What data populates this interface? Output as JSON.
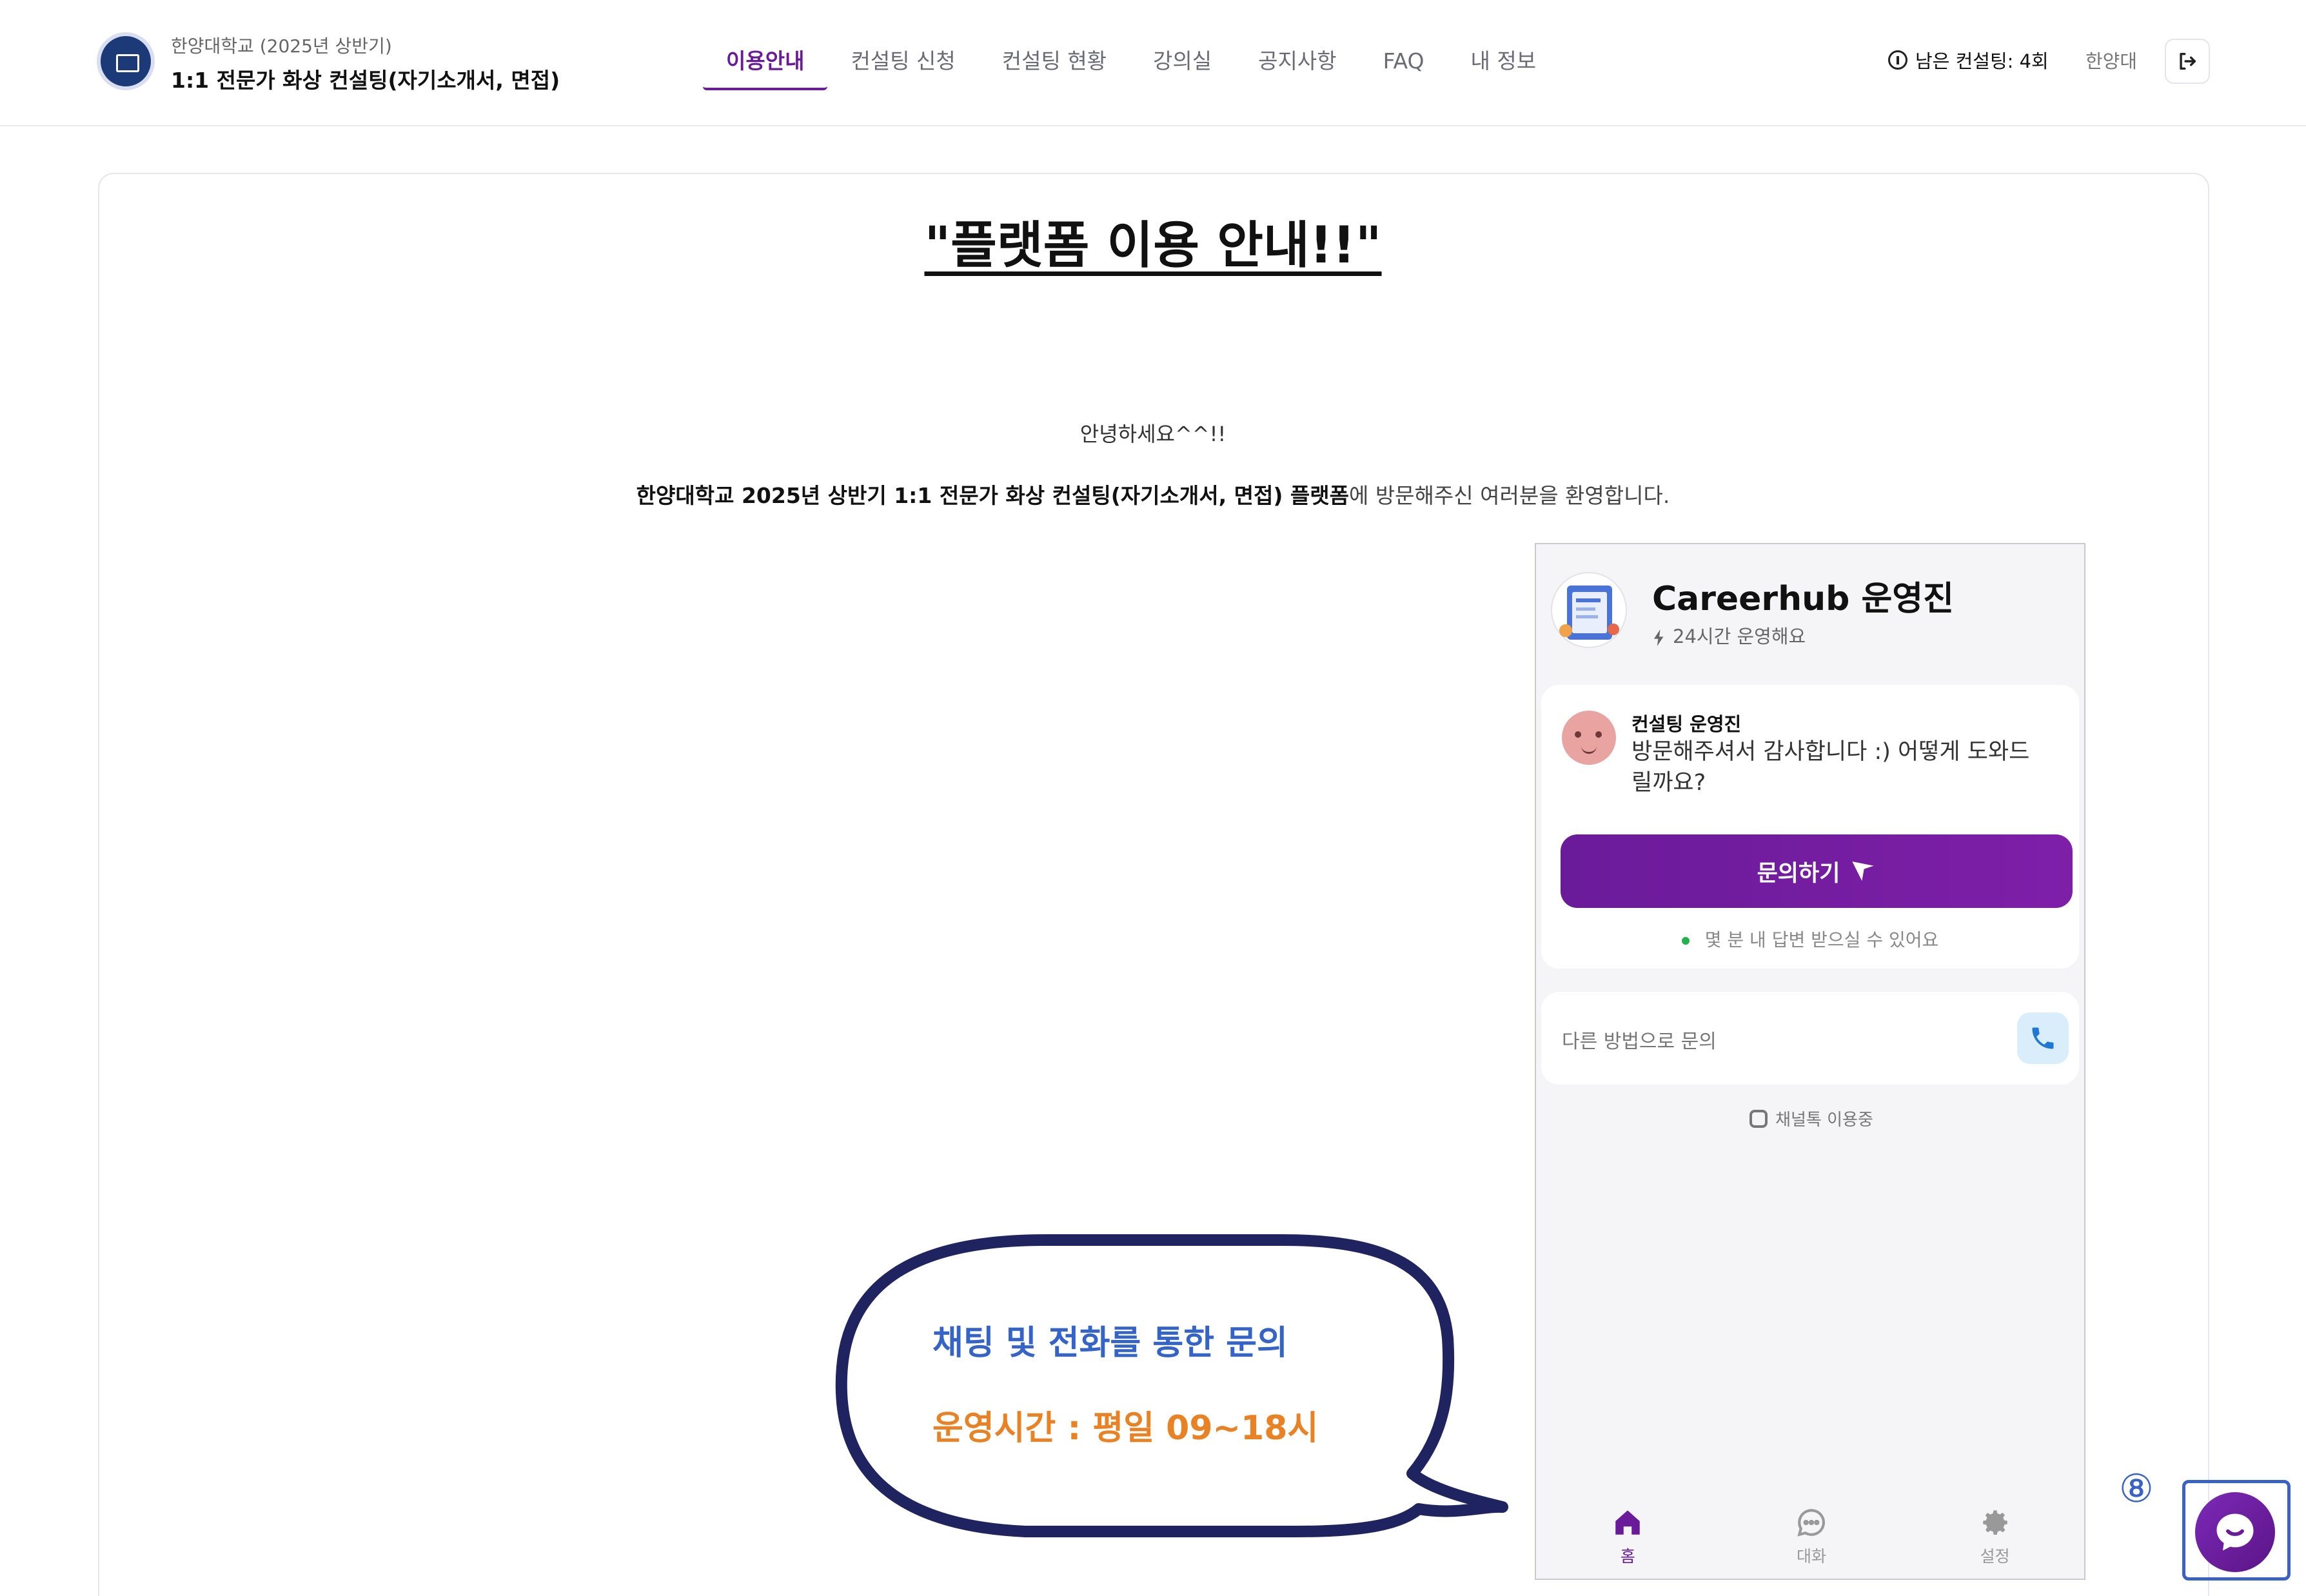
{
  "header": {
    "org": "한양대학교 (2025년 상반기)",
    "program": "1:1 전문가 화상 컨설팅(자기소개서, 면접)",
    "nav": [
      {
        "label": "이용안내",
        "active": true
      },
      {
        "label": "컨설팅 신청",
        "active": false
      },
      {
        "label": "컨설팅 현황",
        "active": false
      },
      {
        "label": "강의실",
        "active": false
      },
      {
        "label": "공지사항",
        "active": false
      },
      {
        "label": "FAQ",
        "active": false
      },
      {
        "label": "내 정보",
        "active": false
      }
    ],
    "remaining_label": "남은 컨설팅: 4회",
    "user": "한양대",
    "icons": {
      "info": "info-icon",
      "logout": "logout-icon"
    }
  },
  "notice": {
    "title": "\"플랫폼 이용 안내!!\"",
    "greeting": "안녕하세요^^!!",
    "welcome_bold": "한양대학교 2025년 상반기 1:1 전문가 화상 컨설팅(자기소개서, 면접) 플랫폼",
    "welcome_rest": "에 방문해주신 여러분을 환영합니다."
  },
  "chat_widget": {
    "title": "Careerhub 운영진",
    "subtitle": "24시간 운영해요",
    "manager_name": "컨설팅 운영진",
    "manager_message": "방문해주셔서 감사합니다 :) 어떻게 도와드릴까요?",
    "inquiry_button": "문의하기",
    "reply_time": "몇 분 내 답변 받으실 수 있어요",
    "other_method": "다른 방법으로 문의",
    "kakao_status": "채널톡 이용중",
    "tabs": [
      {
        "label": "홈",
        "icon": "home-icon",
        "active": true
      },
      {
        "label": "대화",
        "icon": "chat-icon",
        "active": false
      },
      {
        "label": "설정",
        "icon": "gear-icon",
        "active": false
      }
    ],
    "accent_color": "#6a1b9a"
  },
  "callout": {
    "line1": "채팅 및 전화를 통한 문의",
    "line2": "운영시간 : 평일 09~18시"
  },
  "launcher": {
    "marker": "⑧"
  }
}
